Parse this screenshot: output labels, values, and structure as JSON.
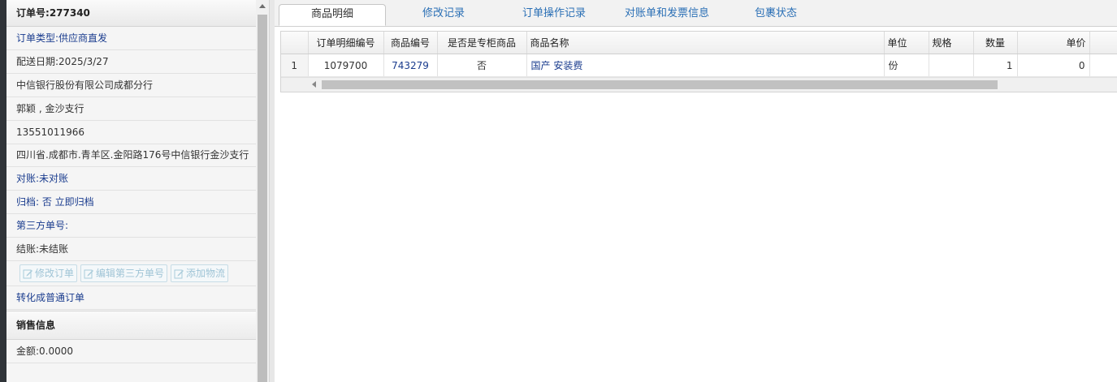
{
  "order": {
    "number_label": "订单号:",
    "number": "277340",
    "type": "订单类型:供应商直发",
    "delivery_date": "配送日期:2025/3/27",
    "company": "中信银行股份有限公司成都分行",
    "contact": "郭颖 , 金沙支行",
    "phone": "13551011966",
    "address": "四川省.成都市.青羊区.金阳路176号中信银行金沙支行",
    "reconcile": "对账:未对账",
    "archive": "归档: 否 立即归档",
    "third_party": "第三方单号:",
    "settle": "结账:未结账"
  },
  "actions": {
    "modify_order": "修改订单",
    "edit_third_party": "编辑第三方单号",
    "add_logistics": "添加物流"
  },
  "convert_link": "转化成普通订单",
  "sales": {
    "title": "销售信息",
    "amount": "金额:0.0000"
  },
  "tabs": [
    {
      "label": "商品明细",
      "active": true
    },
    {
      "label": "修改记录",
      "active": false
    },
    {
      "label": "订单操作记录",
      "active": false
    },
    {
      "label": "对账单和发票信息",
      "active": false
    },
    {
      "label": "包裹状态",
      "active": false
    }
  ],
  "table": {
    "columns": [
      "订单明细编号",
      "商品编号",
      "是否是专柜商品",
      "商品名称",
      "单位",
      "规格",
      "数量",
      "单价"
    ],
    "rows": [
      {
        "index": "1",
        "detail_id": "1079700",
        "product_id": "743279",
        "is_counter": "否",
        "name": "国产 安装费",
        "unit": "份",
        "spec": "",
        "qty": "1",
        "price": "0"
      }
    ]
  },
  "colors": {
    "link_blue": "#1a3c8e",
    "tab_blue": "#2a6fb5",
    "disabled_button_text": "#9fc4d6"
  },
  "icons": [
    "edit-icon",
    "scroll-arrow-up-icon",
    "scroll-arrow-left-icon"
  ]
}
